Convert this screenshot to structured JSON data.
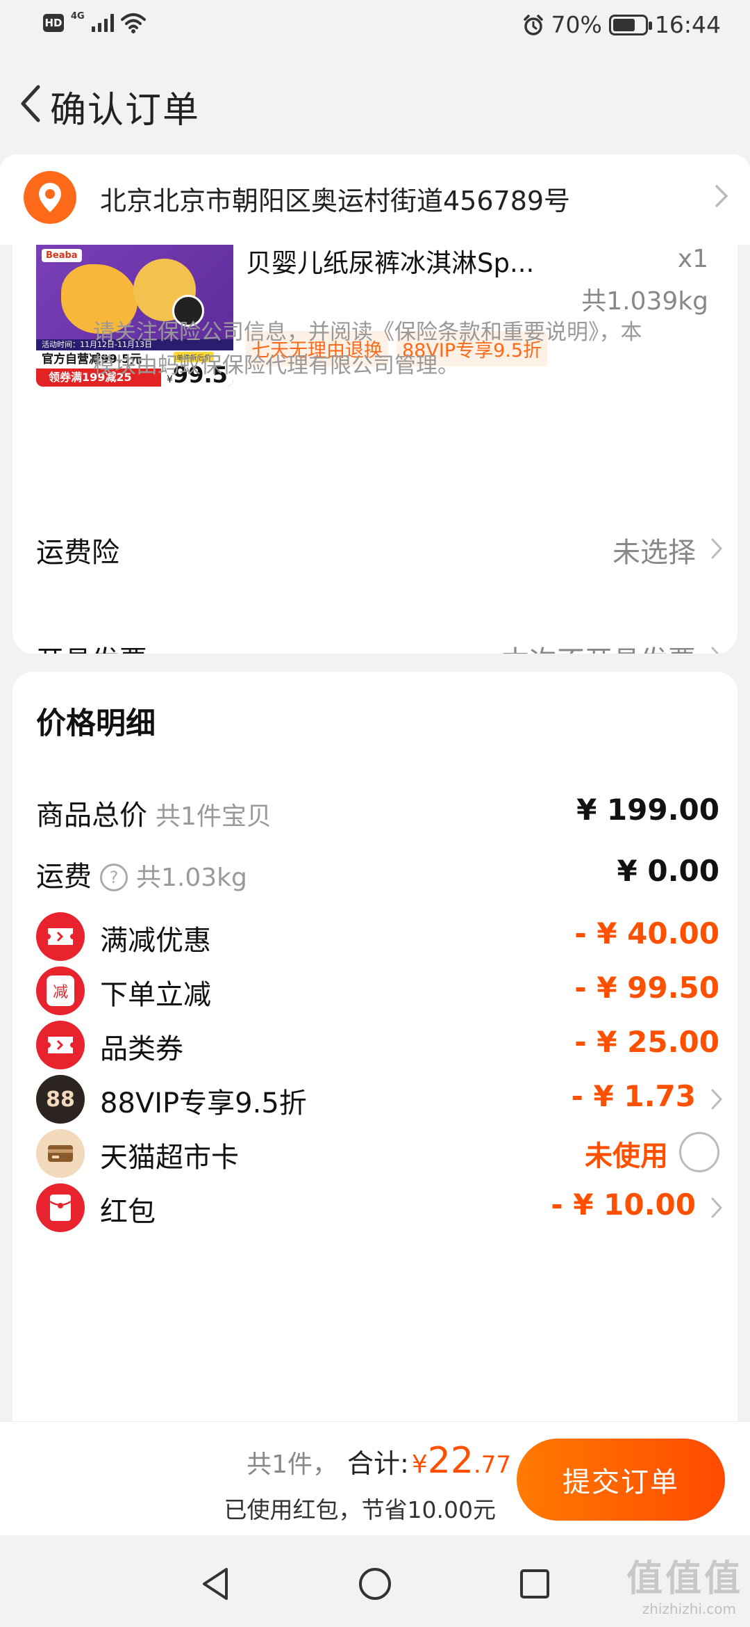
{
  "status_bar": {
    "hd": "HD",
    "network": "4G",
    "battery_percent": "70%",
    "battery_level": 0.7,
    "time": "16:44"
  },
  "nav": {
    "title": "确认订单"
  },
  "address": {
    "text": "北京北京市朝阳区奥运村街道456789号"
  },
  "product": {
    "name": "贝婴儿纸尿裤冰淇淋Sp...",
    "quantity": "x1",
    "weight": "共1.039kg",
    "tags": [
      "七天无理由退换",
      "88VIP专享9.5折"
    ],
    "image": {
      "brand": "Beaba",
      "activity": "活动时间：11月12日-11月13日",
      "promo1": "官方自营减99.5元",
      "promo2": "领券满199减25",
      "price_label": "单件折后价",
      "price_currency": "¥",
      "price": "99.5"
    }
  },
  "insurance": {
    "label": "运费险",
    "value": "未选择",
    "note": "请关注保险公司信息，并阅读《保险条款和重要说明》，本模块由蚂蚁保保险代理有限公司管理。"
  },
  "invoice": {
    "label": "开具发票",
    "value": "本次不开具发票"
  },
  "price_detail": {
    "title": "价格明细",
    "total": {
      "label": "商品总价",
      "sub": "共1件宝贝",
      "amount": "¥ 199.00"
    },
    "shipping": {
      "label": "运费",
      "help": "?",
      "sub": "共1.03kg",
      "amount": "¥ 0.00"
    },
    "discounts": [
      {
        "label": "满减优惠",
        "amount": "- ¥ 40.00",
        "icon": "ticket-icon",
        "color": "#e8232e"
      },
      {
        "label": "下单立减",
        "amount": "- ¥ 99.50",
        "icon": "jian-icon",
        "color": "#e8232e",
        "icon_text": "减"
      },
      {
        "label": "品类券",
        "amount": "- ¥ 25.00",
        "icon": "ticket-icon",
        "color": "#e8232e"
      },
      {
        "label": "88VIP专享9.5折",
        "amount": "- ¥ 1.73",
        "icon": "vip88-icon",
        "color": "#2b2420",
        "icon_text": "88"
      },
      {
        "label": "天猫超市卡",
        "amount": "未使用",
        "icon": "card-icon",
        "color": "#f3d9bb"
      },
      {
        "label": "红包",
        "amount": "- ¥ 10.00",
        "icon": "red-envelope-icon",
        "color": "#e8232e"
      }
    ]
  },
  "submit_bar": {
    "count": "共1件，",
    "total_label": "合计:",
    "currency": "¥",
    "total_int": "22",
    "total_dec": ".77",
    "saved": "已使用红包，节省10.00元",
    "button": "提交订单"
  },
  "watermark": {
    "text": "值值值",
    "sub": "zhizhizhi.com"
  },
  "colors": {
    "accent": "#ff5000",
    "orange": "#ff6a1a",
    "background": "#f2f2f2"
  }
}
